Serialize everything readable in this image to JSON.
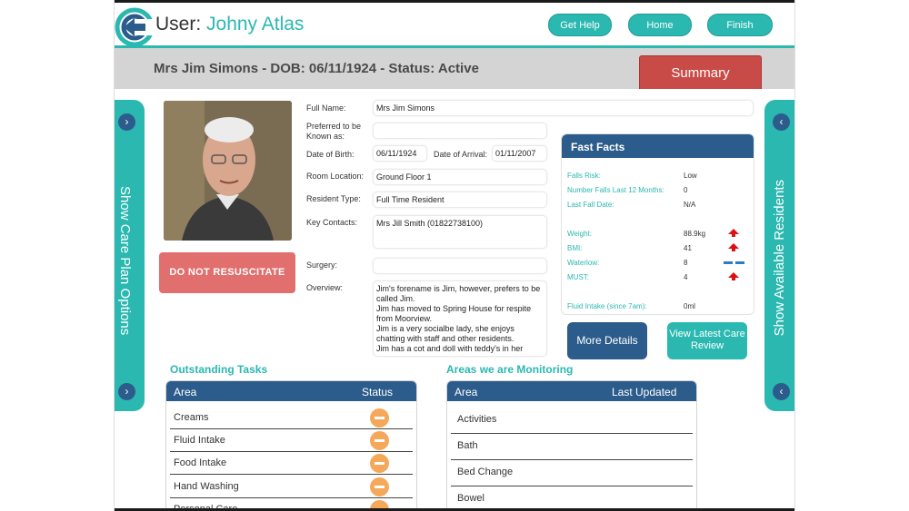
{
  "header": {
    "user_prefix": "User: ",
    "user_name": "Johny Atlas",
    "buttons": {
      "help": "Get Help",
      "home": "Home",
      "finish": "Finish"
    }
  },
  "banner": {
    "title": "Mrs Jim Simons - DOB: 06/11/1924 - Status: Active",
    "summary_label": "Summary"
  },
  "side_left": {
    "label": "Show Care Plan Options",
    "icon": "chevron-right-icon"
  },
  "side_right": {
    "label": "Show Available Residents",
    "icon": "chevron-left-icon"
  },
  "alert": {
    "dnr": "DO NOT RESUSCITATE"
  },
  "resident": {
    "full_name_label": "Full Name:",
    "full_name": "Mrs Jim Simons",
    "known_as_label": "Preferred to be Known as:",
    "known_as": "",
    "dob_label": "Date of Birth:",
    "dob": "06/11/1924",
    "arrival_label": "Date of Arrival:",
    "arrival": "01/11/2007",
    "room_label": "Room Location:",
    "room": "Ground Floor 1",
    "type_label": "Resident Type:",
    "type": "Full Time Resident",
    "contacts_label": "Key Contacts:",
    "contacts": "Mrs Jill Smith (01822738100)",
    "surgery_label": "Surgery:",
    "surgery": "",
    "overview_label": "Overview:",
    "overview": "Jim's forename is Jim, however, prefers to be called Jim.\nJim has moved to Spring House for respite from Moorview.\nJim is a very socialbe lady, she enjoys chatting with staff and other residents.\nJim has a cot and doll with teddy's in her"
  },
  "fast_facts": {
    "title": "Fast Facts",
    "falls_risk_label": "Falls Risk:",
    "falls_risk": "Low",
    "falls_count_label": "Number Falls Last 12 Months:",
    "falls_count": "0",
    "last_fall_label": "Last Fall Date:",
    "last_fall": "N/A",
    "weight_label": "Weight:",
    "weight": "88.9kg",
    "bmi_label": "BMI:",
    "bmi": "41",
    "waterlow_label": "Waterlow:",
    "waterlow": "8",
    "must_label": "MUST:",
    "must": "4",
    "fluid_label": "Fluid Intake (since 7am):",
    "fluid": "0ml",
    "trend_colors": {
      "up": "#dd1111",
      "steady": "#2c7cc4"
    }
  },
  "actions": {
    "more_details": "More Details",
    "care_review": "View Latest Care Review"
  },
  "tasks": {
    "title": "Outstanding Tasks",
    "col_area": "Area",
    "col_status": "Status",
    "rows": [
      "Creams",
      "Fluid Intake",
      "Food Intake",
      "Hand Washing",
      "Personal Care"
    ]
  },
  "monitoring": {
    "title": "Areas we are Monitoring",
    "col_area": "Area",
    "col_updated": "Last Updated",
    "rows": [
      "Activities",
      "Bath",
      "Bed Change",
      "Bowel"
    ]
  },
  "colors": {
    "accent": "#2bb8b1",
    "navy": "#2c5c8c",
    "alert": "#e06f6d",
    "summary": "#c94b48",
    "status": "#f5a85a"
  }
}
